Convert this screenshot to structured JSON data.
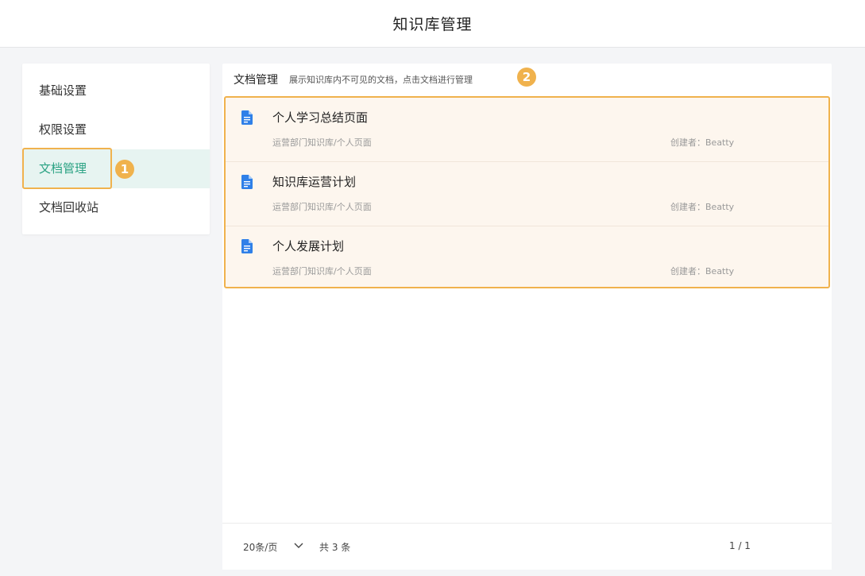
{
  "header": {
    "title": "知识库管理"
  },
  "sidebar": {
    "items": [
      {
        "label": "基础设置"
      },
      {
        "label": "权限设置"
      },
      {
        "label": "文档管理",
        "active": true
      },
      {
        "label": "文档回收站"
      }
    ]
  },
  "annotations": {
    "badge1": "1",
    "badge2": "2"
  },
  "panel": {
    "title": "文档管理",
    "description": "展示知识库内不可见的文档，点击文档进行管理"
  },
  "documents": [
    {
      "name": "个人学习总结页面",
      "path": "运营部门知识库/个人页面",
      "creator": "创建者：Beatty",
      "icon": "document-icon"
    },
    {
      "name": "知识库运营计划",
      "path": "运营部门知识库/个人页面",
      "creator": "创建者：Beatty",
      "icon": "document-icon"
    },
    {
      "name": "个人发展计划",
      "path": "运营部门知识库/个人页面",
      "creator": "创建者：Beatty",
      "icon": "document-icon"
    }
  ],
  "pagination": {
    "page_size": "20条/页",
    "total": "共 3 条",
    "pages": "1 / 1"
  },
  "colors": {
    "accent": "#2aa283",
    "highlight": "#f0b24d",
    "doc_icon": "#2f80e8"
  }
}
